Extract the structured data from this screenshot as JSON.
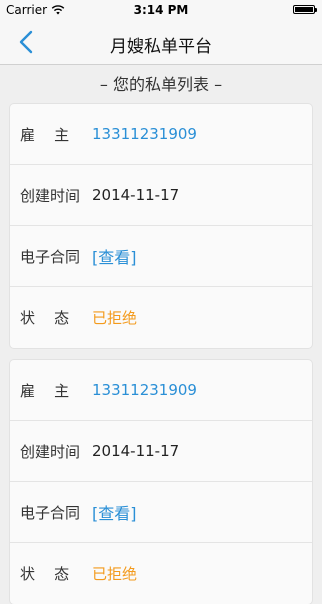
{
  "statusbar": {
    "carrier": "Carrier",
    "time": "3:14 PM",
    "battery_level": 1.0
  },
  "navbar": {
    "back_icon": "chevron-left-icon",
    "title": "月嫂私单平台"
  },
  "section": {
    "title": "– 您的私单列表 –"
  },
  "colors": {
    "accent_blue": "#2a8fd6",
    "status_orange": "#f39a1c",
    "background": "#efefef"
  },
  "orders": [
    {
      "employer_label": "雇    主",
      "employer_value": "13311231909",
      "created_label": "创建时间",
      "created_value": "2014-11-17",
      "contract_label": "电子合同",
      "contract_value": "[查看]",
      "status_label": "状    态",
      "status_value": "已拒绝"
    },
    {
      "employer_label": "雇    主",
      "employer_value": "13311231909",
      "created_label": "创建时间",
      "created_value": "2014-11-17",
      "contract_label": "电子合同",
      "contract_value": "[查看]",
      "status_label": "状    态",
      "status_value": "已拒绝"
    }
  ]
}
